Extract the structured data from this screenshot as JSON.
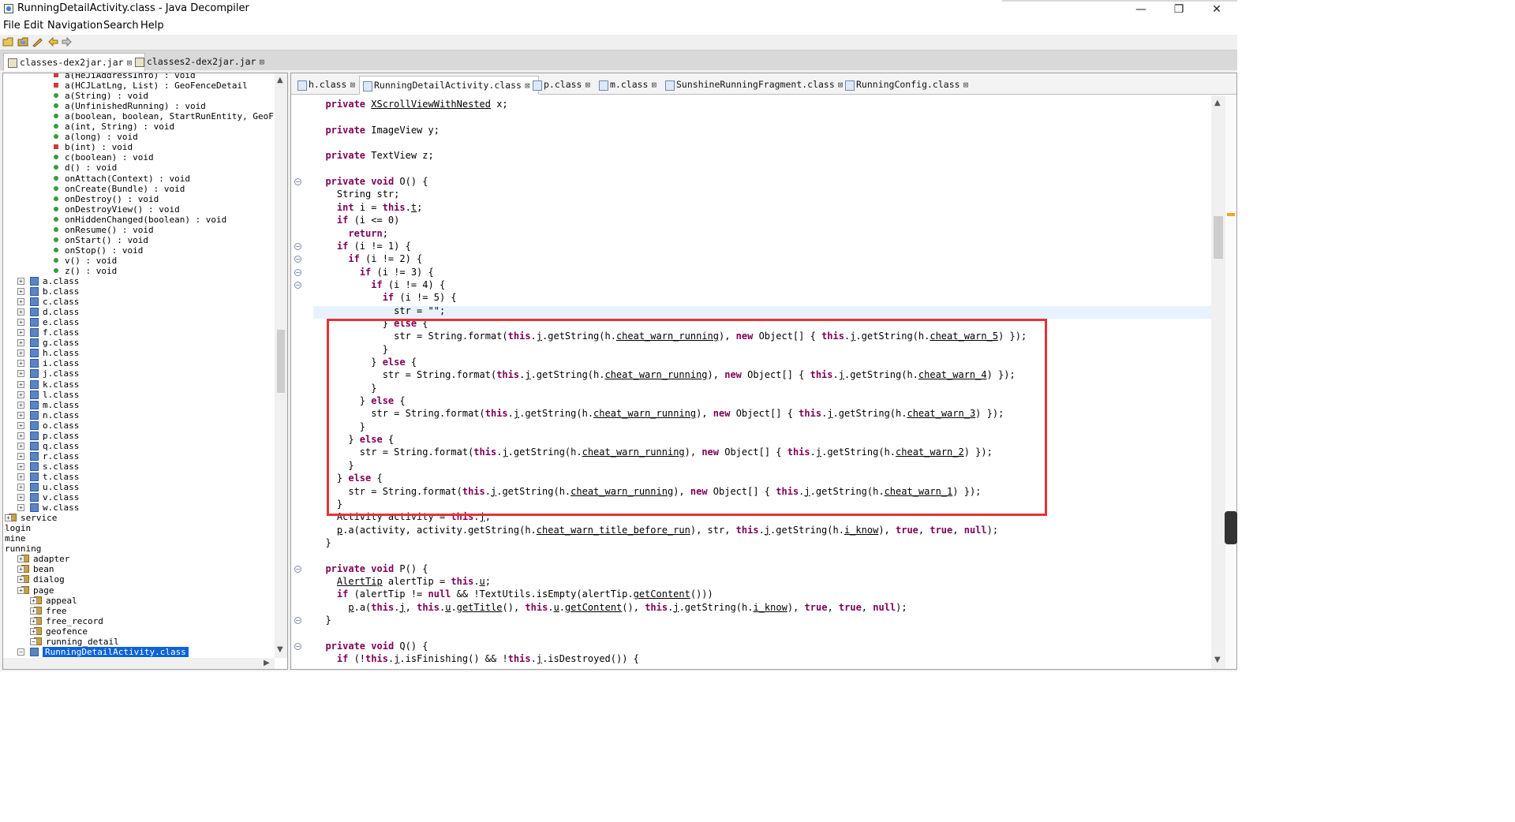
{
  "window": {
    "title": "RunningDetailActivity.class - Java Decompiler",
    "minimize_glyph": "—",
    "restore_glyph": "❐",
    "close_glyph": "✕"
  },
  "menu": [
    "File",
    "Edit",
    "Navigation",
    "Search",
    "Help"
  ],
  "toolbar_icons": [
    "open-file-icon",
    "open-folder-icon",
    "settings-wrench-icon",
    "back-arrow-icon",
    "forward-arrow-icon"
  ],
  "jar_tabs": [
    {
      "label": "classes-dex2jar.jar",
      "active": true
    },
    {
      "label": "classes2-dex2jar.jar",
      "active": false
    }
  ],
  "tree": {
    "members": [
      {
        "kind": "private",
        "label": "a(HeJiAddressInfo) : void"
      },
      {
        "kind": "private",
        "label": "a(HCJLatLng, List) : GeoFenceDetail"
      },
      {
        "kind": "public",
        "label": "a(String) : void"
      },
      {
        "kind": "public",
        "label": "a(UnfinishedRunning) : void"
      },
      {
        "kind": "public",
        "label": "a(boolean, boolean, StartRunEntity, GeoF"
      },
      {
        "kind": "public",
        "label": "a(int, String) : void"
      },
      {
        "kind": "public",
        "label": "a(long) : void"
      },
      {
        "kind": "private",
        "label": "b(int) : void"
      },
      {
        "kind": "public",
        "label": "c(boolean) : void"
      },
      {
        "kind": "public",
        "label": "d() : void"
      },
      {
        "kind": "public",
        "label": "onAttach(Context) : void"
      },
      {
        "kind": "public",
        "label": "onCreate(Bundle) : void"
      },
      {
        "kind": "public",
        "label": "onDestroy() : void"
      },
      {
        "kind": "public",
        "label": "onDestroyView() : void"
      },
      {
        "kind": "public",
        "label": "onHiddenChanged(boolean) : void"
      },
      {
        "kind": "public",
        "label": "onResume() : void"
      },
      {
        "kind": "public",
        "label": "onStart() : void"
      },
      {
        "kind": "public",
        "label": "onStop() : void"
      },
      {
        "kind": "public",
        "label": "v() : void"
      },
      {
        "kind": "public",
        "label": "z() : void"
      }
    ],
    "classes": [
      "a.class",
      "b.class",
      "c.class",
      "d.class",
      "e.class",
      "f.class",
      "g.class",
      "h.class",
      "i.class",
      "j.class",
      "k.class",
      "l.class",
      "m.class",
      "n.class",
      "o.class",
      "p.class",
      "q.class",
      "r.class",
      "s.class",
      "t.class",
      "u.class",
      "v.class",
      "w.class"
    ],
    "packages": [
      {
        "label": "service",
        "indent": 0,
        "icon": true
      },
      {
        "label": "login",
        "indent": 0,
        "icon": false
      },
      {
        "label": "mine",
        "indent": 0,
        "icon": false
      },
      {
        "label": "running",
        "indent": 0,
        "icon": false
      },
      {
        "label": "adapter",
        "indent": 1,
        "icon": true
      },
      {
        "label": "bean",
        "indent": 1,
        "icon": true
      },
      {
        "label": "dialog",
        "indent": 1,
        "icon": true
      },
      {
        "label": "page",
        "indent": 1,
        "icon": true
      },
      {
        "label": "appeal",
        "indent": 2,
        "icon": true
      },
      {
        "label": "free",
        "indent": 2,
        "icon": true
      },
      {
        "label": "free_record",
        "indent": 2,
        "icon": true
      },
      {
        "label": "geofence",
        "indent": 2,
        "icon": true
      },
      {
        "label": "running_detail",
        "indent": 2,
        "icon": true
      }
    ],
    "selected": "RunningDetailActivity.class"
  },
  "editor_tabs": [
    {
      "label": "h.class",
      "active": false
    },
    {
      "label": "RunningDetailActivity.class",
      "active": true
    },
    {
      "label": "p.class",
      "active": false
    },
    {
      "label": "m.class",
      "active": false
    },
    {
      "label": "SunshineRunningFragment.class",
      "active": false
    },
    {
      "label": "RunningConfig.class",
      "active": false
    }
  ],
  "code_lines": [
    "  private XScrollViewWithNested x;",
    "",
    "  private ImageView y;",
    "",
    "  private TextView z;",
    "",
    "  private void O() {",
    "    String str;",
    "    int i = this.t;",
    "    if (i <= 0)",
    "      return;",
    "    if (i != 1) {",
    "      if (i != 2) {",
    "        if (i != 3) {",
    "          if (i != 4) {",
    "            if (i != 5) {",
    "              str = \"\";",
    "            } else {",
    "              str = String.format(this.j.getString(h.cheat_warn_running), new Object[] { this.j.getString(h.cheat_warn_5) });",
    "            }",
    "          } else {",
    "            str = String.format(this.j.getString(h.cheat_warn_running), new Object[] { this.j.getString(h.cheat_warn_4) });",
    "          }",
    "        } else {",
    "          str = String.format(this.j.getString(h.cheat_warn_running), new Object[] { this.j.getString(h.cheat_warn_3) });",
    "        }",
    "      } else {",
    "        str = String.format(this.j.getString(h.cheat_warn_running), new Object[] { this.j.getString(h.cheat_warn_2) });",
    "      }",
    "    } else {",
    "      str = String.format(this.j.getString(h.cheat_warn_running), new Object[] { this.j.getString(h.cheat_warn_1) });",
    "    }",
    "    Activity activity = this.j;",
    "    p.a(activity, activity.getString(h.cheat_warn_title_before_run), str, this.j.getString(h.i_know), true, true, null);",
    "  }",
    "",
    "  private void P() {",
    "    AlertTip alertTip = this.u;",
    "    if (alertTip != null && !TextUtils.isEmpty(alertTip.getContent()))",
    "      p.a(this.j, this.u.getTitle(), this.u.getContent(), this.j.getString(h.i_know), true, true, null);",
    "  }",
    "",
    "  private void Q() {",
    "    if (!this.j.isFinishing() && !this.j.isDestroyed()) {"
  ],
  "fold_markers": [
    "⊖",
    "⊖",
    "⊖",
    "⊖",
    "⊖",
    "⊖",
    "⊖",
    "⊖",
    "⊖"
  ],
  "highlight": {
    "annotation": "red-box",
    "color": "#e53236"
  },
  "colors": {
    "keyword": "#7f0055",
    "selection": "#0b63d7",
    "current_line": "#e8f2fe",
    "occurrence": "#f0a81f"
  }
}
